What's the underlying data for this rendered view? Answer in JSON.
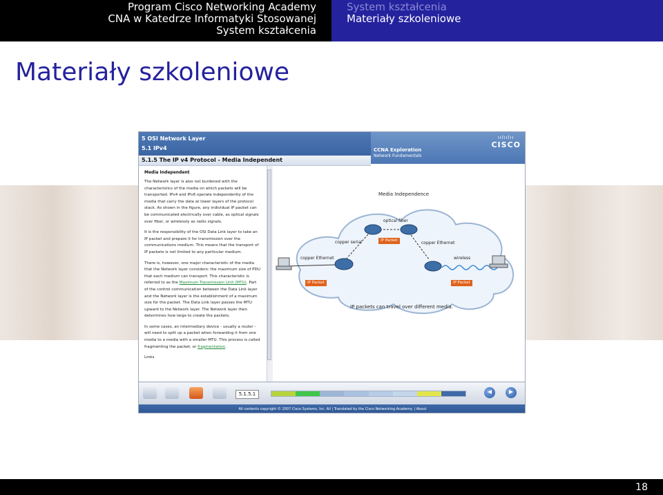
{
  "header": {
    "left_line1": "Program Cisco Networking Academy",
    "left_line2": "CNA w Katedrze Informatyki Stosowanej",
    "left_line3": "System kształcenia",
    "right_line1": "System kształcenia",
    "right_line2": "Materiały szkoleniowe"
  },
  "slide": {
    "title": "Materiały szkoleniowe",
    "page_number": "18"
  },
  "ccna": {
    "chapter": "5 OSI Network Layer",
    "section": "5.1 IPv4",
    "topic": "5.1.5 The IP v4 Protocol - Media Independent",
    "course_title": "CCNA Exploration",
    "course_subtitle": "Network Fundamentals",
    "brand_bars": "ıılıılıı",
    "brand": "CISCO",
    "text_heading": "Media Independent",
    "paragraph1": "The Network layer is also not burdened with the characteristics of the media on which packets will be transported. IPv4 and IPv6 operate independently of the media that carry the data at lower layers of the protocol stack. As shown in the figure, any individual IP packet can be communicated electrically over cable, as optical signals over fiber, or wirelessly as radio signals.",
    "paragraph2": "It is the responsibility of the OSI Data Link layer to take an IP packet and prepare it for transmission over the communications medium. This means that the transport of IP packets is not limited to any particular medium.",
    "paragraph3_a": "There is, however, one major characteristic of the media that the Network layer considers: the maximum size of PDU that each medium can transport. This characteristic is referred to as the ",
    "paragraph3_link": "Maximum Transmission Unit (MTU)",
    "paragraph3_b": ". Part of the control communication between the Data Link layer and the Network layer is the establishment of a maximum size for the packet. The Data Link layer passes the MTU upward to the Network layer. The Network layer then determines how large to create the packets.",
    "paragraph4_a": "In some cases, an intermediary device - usually a router - will need to split up a packet when forwarding it from one media to a media with a smaller MTU. This process is called fragmenting the packet, or ",
    "paragraph4_link": "fragmentation",
    "paragraph4_b": ".",
    "links_label": "Links",
    "diagram": {
      "title": "Media Independence",
      "optical_fiber": "optical fiber",
      "copper_serial": "copper serial",
      "copper_ethernet_left": "copper Ethernet",
      "copper_ethernet_right": "copper Ethernet",
      "wireless": "wireless",
      "ip_packet_center": "IP Packet",
      "ip_packet_left": "IP Packet",
      "ip_packet_right": "IP Packet",
      "caption": "IP packets can travel over different media."
    },
    "page_box": "5.1.5.1",
    "footer": "All contents copyright © 2007 Cisco Systems, Inc. All | Translated by the Cisco Networking Academy. | About",
    "progress_segments": [
      {
        "color": "#b6d43c"
      },
      {
        "color": "#3fc64a"
      },
      {
        "color": "#9cb6d6"
      },
      {
        "color": "#aac2df"
      },
      {
        "color": "#b7cce6"
      },
      {
        "color": "#c3d6ec"
      },
      {
        "color": "#e3e64a"
      },
      {
        "color": "#3f6aa8"
      }
    ]
  },
  "colors": {
    "beamer_blue": "#25229e",
    "cisco_blue": "#3b64a3",
    "packet_orange": "#e0621c"
  }
}
